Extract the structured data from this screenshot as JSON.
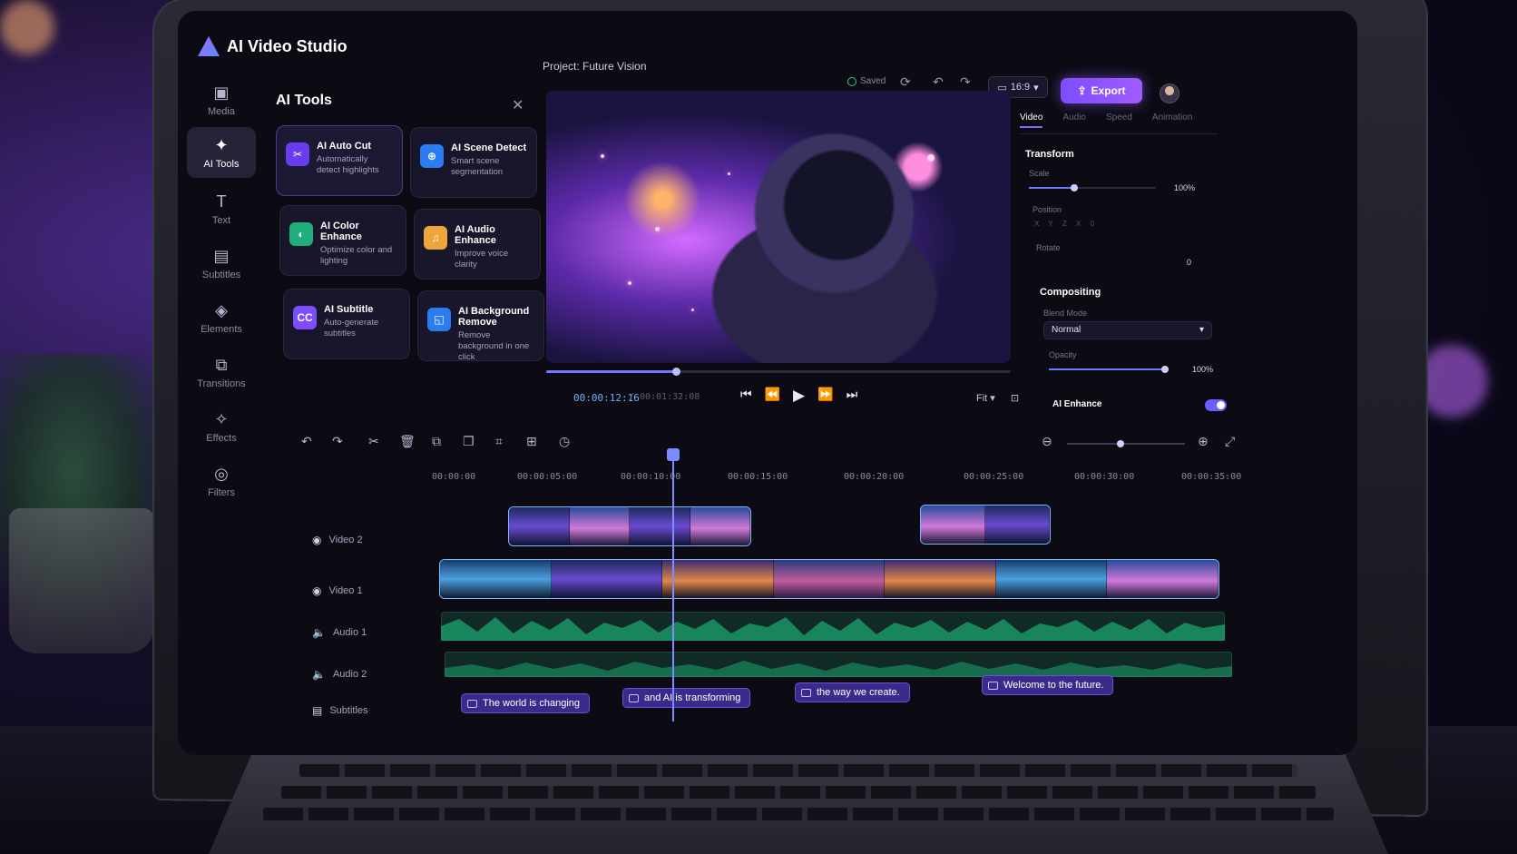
{
  "app": {
    "name": "AI Video Studio",
    "project_title": "Project: Future Vision"
  },
  "header": {
    "saved_label": "Saved",
    "aspect_ratio": "16:9",
    "export_label": "Export"
  },
  "rail": {
    "items": [
      {
        "label": "Media",
        "icon": "media-icon"
      },
      {
        "label": "AI Tools",
        "icon": "ai-tools-icon"
      },
      {
        "label": "Text",
        "icon": "text-icon"
      },
      {
        "label": "Subtitles",
        "icon": "subtitles-icon"
      },
      {
        "label": "Elements",
        "icon": "elements-icon"
      },
      {
        "label": "Transitions",
        "icon": "transitions-icon"
      },
      {
        "label": "Effects",
        "icon": "effects-icon"
      },
      {
        "label": "Filters",
        "icon": "filters-icon"
      }
    ],
    "active": "AI Tools"
  },
  "tools": {
    "title": "AI Tools",
    "cards": [
      {
        "name": "AI Auto Cut",
        "desc": "Automatically detect highlights",
        "icon": "auto-cut-icon",
        "color": "#6a3cf0"
      },
      {
        "name": "AI Scene Detect",
        "desc": "Smart scene segmentation",
        "icon": "scene-detect-icon",
        "color": "#2a7cf0"
      },
      {
        "name": "AI Color Enhance",
        "desc": "Optimize color and lighting",
        "icon": "color-enhance-icon",
        "color": "#1fae7a"
      },
      {
        "name": "AI Audio Enhance",
        "desc": "Improve voice clarity",
        "icon": "audio-enhance-icon",
        "color": "#f0a53c"
      },
      {
        "name": "AI Subtitle",
        "desc": "Auto-generate subtitles",
        "icon": "cc-icon",
        "color": "#7c4dff",
        "glyph": "CC"
      },
      {
        "name": "AI Background Remove",
        "desc": "Remove background in one click",
        "icon": "bg-remove-icon",
        "color": "#2a7cf0"
      }
    ]
  },
  "player": {
    "current_time": "00:00:12:16",
    "total_time": "/ 00:01:32:08",
    "progress": 0.28,
    "fit_label": "Fit"
  },
  "props": {
    "tabs": [
      "Video",
      "Audio",
      "Speed",
      "Animation"
    ],
    "active_tab": "Video",
    "transform_title": "Transform",
    "scale_label": "Scale",
    "scale_value": "100%",
    "position_label": "Position",
    "position_axes": "X   Y   Z   X   0",
    "rotate_label": "Rotate",
    "rotate_value": "0",
    "compositing_title": "Compositing",
    "blend_label": "Blend Mode",
    "blend_value": "Normal",
    "opacity_label": "Opacity",
    "opacity_value": "100%",
    "ai_enhance_label": "AI Enhance",
    "ai_enhance_on": true
  },
  "timeline": {
    "ruler": [
      "00:00:00",
      "00:00:05:00",
      "00:00:10:00",
      "00:00:15:00",
      "00:00:20:00",
      "00:00:25:00",
      "00:00:30:00",
      "00:00:35:00"
    ],
    "tracks": [
      {
        "label": "Video 2",
        "icon": "eye-icon"
      },
      {
        "label": "Video 1",
        "icon": "eye-icon"
      },
      {
        "label": "Audio 1",
        "icon": "speaker-icon"
      },
      {
        "label": "Audio 2",
        "icon": "speaker-icon"
      },
      {
        "label": "Subtitles",
        "icon": "subtitle-track-icon"
      }
    ],
    "subtitles": [
      "The world is changing",
      "and AI is transforming",
      "the way we create.",
      "Welcome to the future."
    ]
  }
}
